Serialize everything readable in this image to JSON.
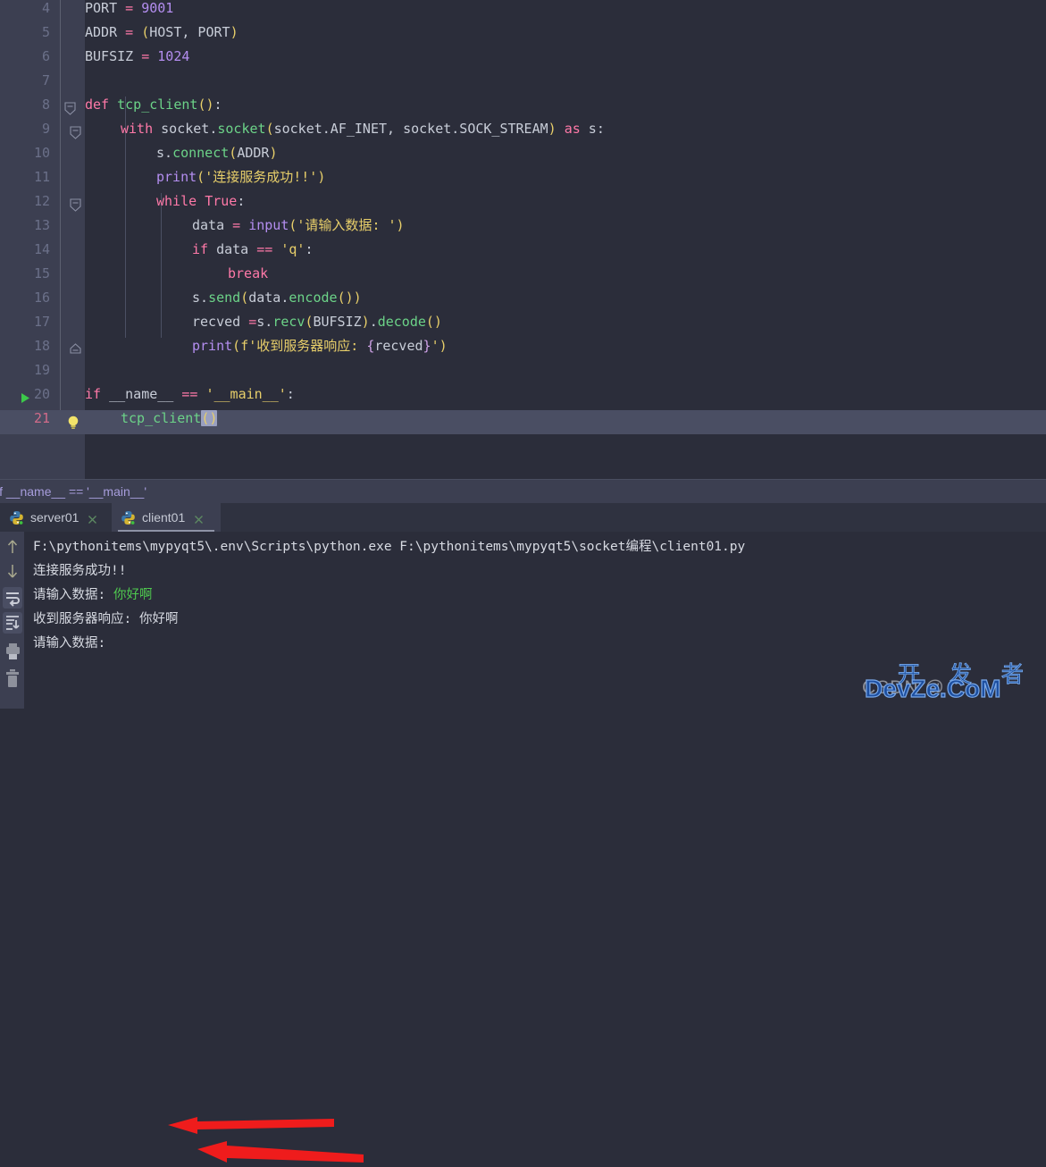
{
  "app": {
    "name": "PyCharm",
    "theme_bg": "#2b2d3a",
    "gutter_bg": "#3c3f51",
    "accent_green": "#4fc94f",
    "annotation_color": "#ef1c1c"
  },
  "editor": {
    "first_visible_line": 4,
    "caret_line": 21,
    "lines": [
      {
        "num": 4,
        "indent": 1,
        "text": "PORT = 9001",
        "tokens": [
          {
            "t": "PORT",
            "c": "plain"
          },
          {
            "t": " = ",
            "c": "op"
          },
          {
            "t": "9001",
            "c": "num"
          }
        ]
      },
      {
        "num": 5,
        "indent": 1,
        "text": "ADDR = (HOST, PORT)",
        "tokens": [
          {
            "t": "ADDR",
            "c": "plain"
          },
          {
            "t": " = ",
            "c": "op"
          },
          {
            "t": "(",
            "c": "paren"
          },
          {
            "t": "HOST, PORT",
            "c": "plain"
          },
          {
            "t": ")",
            "c": "paren"
          }
        ]
      },
      {
        "num": 6,
        "indent": 1,
        "text": "BUFSIZ = 1024",
        "tokens": [
          {
            "t": "BUFSIZ",
            "c": "plain"
          },
          {
            "t": " = ",
            "c": "op"
          },
          {
            "t": "1024",
            "c": "num"
          }
        ]
      },
      {
        "num": 7,
        "indent": 0,
        "text": "",
        "tokens": []
      },
      {
        "num": 8,
        "indent": 1,
        "text": "def tcp_client():",
        "tokens": [
          {
            "t": "def ",
            "c": "kw"
          },
          {
            "t": "tcp_client",
            "c": "fn"
          },
          {
            "t": "()",
            "c": "paren"
          },
          {
            "t": ":",
            "c": "plain"
          }
        ]
      },
      {
        "num": 9,
        "indent": 2,
        "text": "with socket.socket(socket.AF_INET, socket.SOCK_STREAM) as s:",
        "tokens": [
          {
            "t": "with ",
            "c": "kw"
          },
          {
            "t": "socket.",
            "c": "plain"
          },
          {
            "t": "socket",
            "c": "fn"
          },
          {
            "t": "(",
            "c": "paren"
          },
          {
            "t": "socket.AF_INET, socket.SOCK_STREAM",
            "c": "plain"
          },
          {
            "t": ")",
            "c": "paren"
          },
          {
            "t": " as ",
            "c": "kw"
          },
          {
            "t": "s:",
            "c": "plain"
          }
        ]
      },
      {
        "num": 10,
        "indent": 3,
        "text": "s.connect(ADDR)",
        "tokens": [
          {
            "t": "s.",
            "c": "plain"
          },
          {
            "t": "connect",
            "c": "fn"
          },
          {
            "t": "(",
            "c": "paren"
          },
          {
            "t": "ADDR",
            "c": "plain"
          },
          {
            "t": ")",
            "c": "paren"
          }
        ]
      },
      {
        "num": 11,
        "indent": 3,
        "text": "print('连接服务成功!!')",
        "tokens": [
          {
            "t": "print",
            "c": "builtin"
          },
          {
            "t": "(",
            "c": "paren"
          },
          {
            "t": "'连接服务成功!!'",
            "c": "str"
          },
          {
            "t": ")",
            "c": "paren"
          }
        ]
      },
      {
        "num": 12,
        "indent": 3,
        "text": "while True:",
        "tokens": [
          {
            "t": "while ",
            "c": "kw"
          },
          {
            "t": "True",
            "c": "kw"
          },
          {
            "t": ":",
            "c": "plain"
          }
        ]
      },
      {
        "num": 13,
        "indent": 4,
        "text": "data = input('请输入数据: ')",
        "tokens": [
          {
            "t": "data",
            "c": "plain"
          },
          {
            "t": " = ",
            "c": "op"
          },
          {
            "t": "input",
            "c": "builtin"
          },
          {
            "t": "(",
            "c": "paren"
          },
          {
            "t": "'请输入数据: '",
            "c": "str"
          },
          {
            "t": ")",
            "c": "paren"
          }
        ]
      },
      {
        "num": 14,
        "indent": 4,
        "text": "if data == 'q':",
        "tokens": [
          {
            "t": "if ",
            "c": "kw"
          },
          {
            "t": "data ",
            "c": "plain"
          },
          {
            "t": "== ",
            "c": "op"
          },
          {
            "t": "'q'",
            "c": "str"
          },
          {
            "t": ":",
            "c": "plain"
          }
        ]
      },
      {
        "num": 15,
        "indent": 5,
        "text": "break",
        "tokens": [
          {
            "t": "break",
            "c": "kw"
          }
        ]
      },
      {
        "num": 16,
        "indent": 4,
        "text": "s.send(data.encode())",
        "tokens": [
          {
            "t": "s.",
            "c": "plain"
          },
          {
            "t": "send",
            "c": "fn"
          },
          {
            "t": "(",
            "c": "paren"
          },
          {
            "t": "data.",
            "c": "plain"
          },
          {
            "t": "encode",
            "c": "fn"
          },
          {
            "t": "()",
            "c": "paren"
          },
          {
            "t": ")",
            "c": "paren"
          }
        ]
      },
      {
        "num": 17,
        "indent": 4,
        "text": "recved =s.recv(BUFSIZ).decode()",
        "tokens": [
          {
            "t": "recved ",
            "c": "plain"
          },
          {
            "t": "=",
            "c": "op"
          },
          {
            "t": "s.",
            "c": "plain"
          },
          {
            "t": "recv",
            "c": "fn"
          },
          {
            "t": "(",
            "c": "paren"
          },
          {
            "t": "BUFSIZ",
            "c": "plain"
          },
          {
            "t": ")",
            "c": "paren"
          },
          {
            "t": ".",
            "c": "plain"
          },
          {
            "t": "decode",
            "c": "fn"
          },
          {
            "t": "()",
            "c": "paren"
          }
        ]
      },
      {
        "num": 18,
        "indent": 4,
        "text": "print(f'收到服务器响应: {recved}')",
        "tokens": [
          {
            "t": "print",
            "c": "builtin"
          },
          {
            "t": "(",
            "c": "paren"
          },
          {
            "t": "f'收到服务器响应: ",
            "c": "str"
          },
          {
            "t": "{",
            "c": "paren2"
          },
          {
            "t": "recved",
            "c": "plain"
          },
          {
            "t": "}",
            "c": "paren2"
          },
          {
            "t": "'",
            "c": "str"
          },
          {
            "t": ")",
            "c": "paren"
          }
        ]
      },
      {
        "num": 19,
        "indent": 0,
        "text": "",
        "tokens": []
      },
      {
        "num": 20,
        "indent": 1,
        "text": "if __name__ == '__main__':",
        "tokens": [
          {
            "t": "if ",
            "c": "kw"
          },
          {
            "t": "__name__ ",
            "c": "plain"
          },
          {
            "t": "== ",
            "c": "op"
          },
          {
            "t": "'__main__'",
            "c": "str"
          },
          {
            "t": ":",
            "c": "plain"
          }
        ]
      },
      {
        "num": 21,
        "indent": 2,
        "text": "tcp_client()",
        "tokens": [
          {
            "t": "tcp_client",
            "c": "fn"
          }
        ],
        "selected_tail": "()"
      }
    ],
    "fold_markers": [
      {
        "line": 8,
        "type": "open"
      },
      {
        "line": 9,
        "type": "open"
      },
      {
        "line": 12,
        "type": "open"
      },
      {
        "line": 18,
        "type": "end"
      }
    ],
    "run_arrow_line": 20,
    "bulb_line": 21
  },
  "breadcrumb": {
    "text": "if __name__ == '__main__'"
  },
  "run_tabs": [
    {
      "label": "server01",
      "icon": "python-file-icon",
      "active": false,
      "close": "close-icon"
    },
    {
      "label": "client01",
      "icon": "python-file-icon",
      "active": true,
      "close": "close-icon"
    }
  ],
  "console": {
    "toolbar_icons": [
      "up-arrow-icon",
      "down-arrow-icon",
      "soft-wrap-icon",
      "scroll-to-end-icon",
      "print-icon",
      "trash-icon"
    ],
    "lines": [
      {
        "text": "F:\\pythonitems\\mypyqt5\\.env\\Scripts\\python.exe F:\\pythonitems\\mypyqt5\\socket编程\\client01.py",
        "color": "#d7dae2"
      },
      {
        "text": "连接服务成功!!",
        "color": "#d7dae2"
      },
      {
        "prefix": "请输入数据: ",
        "input": "你好啊",
        "color": "#d7dae2",
        "input_color": "#4fc94f"
      },
      {
        "text": "收到服务器响应: 你好啊",
        "color": "#d7dae2"
      },
      {
        "text": "请输入数据: ",
        "color": "#d7dae2"
      }
    ]
  },
  "annotations": [
    {
      "name": "arrow-to-user-input",
      "points_to": "你好啊"
    },
    {
      "name": "arrow-to-server-response",
      "points_to": "收到服务器响应: 你好啊"
    }
  ],
  "watermark": {
    "csdn": "CSDN @",
    "chinese": "开 发 者",
    "site": "DevZe.CoM"
  }
}
